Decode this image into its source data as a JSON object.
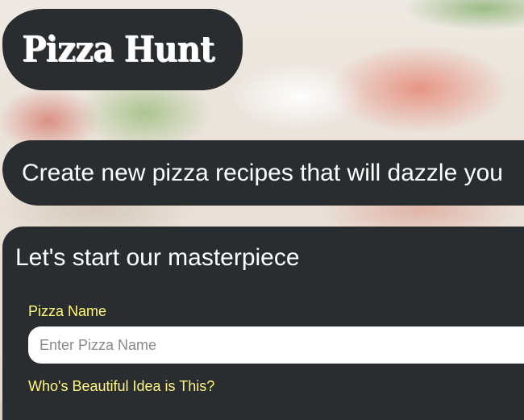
{
  "brand": {
    "title": "Pizza Hunt"
  },
  "tagline": {
    "text": "Create new pizza recipes that will dazzle you"
  },
  "form": {
    "heading": "Let's start our masterpiece",
    "pizza_name_label": "Pizza Name",
    "pizza_name_placeholder": "Enter Pizza Name",
    "pizza_name_value": "",
    "author_label": "Who's Beautiful Idea is This?"
  },
  "colors": {
    "panel": "#2a2d30",
    "label_accent": "#fff87a",
    "text": "#ffffff"
  }
}
